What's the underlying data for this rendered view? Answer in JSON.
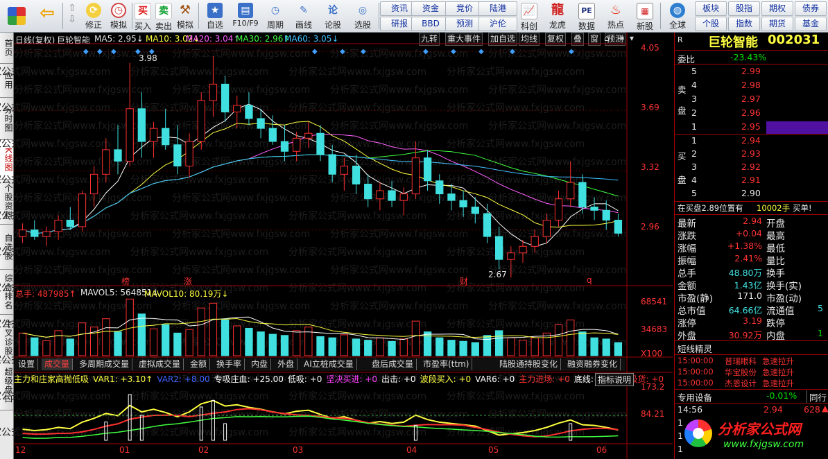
{
  "toolbar": {
    "buttons_left": [
      "修正",
      "模拟"
    ],
    "trade_buttons": [
      "买入",
      "卖出"
    ],
    "nav_buttons": [
      "自选",
      "F10/F9",
      "周期",
      "画线",
      "论股",
      "选股"
    ],
    "small_row1": [
      "资讯",
      "资金",
      "竞价",
      "陆港"
    ],
    "small_row2": [
      "研报",
      "BBD",
      "预测",
      "沪伦"
    ],
    "right_buttons": [
      "科创",
      "龙虎",
      "数据",
      "热点",
      "新股"
    ],
    "global_label": "全球",
    "right_small_row1": [
      "板块",
      "股指",
      "期权",
      "债券"
    ],
    "right_small_row2": [
      "个股",
      "指数",
      "期货",
      "基金"
    ],
    "icon_buy": "买",
    "icon_sell": "卖",
    "icon_brief": "论",
    "icon_pe": "PE"
  },
  "left_tabs": [
    "首页",
    "应用",
    "分时图",
    "K线图",
    "个股资料",
    "自选股",
    "综合排名",
    "牛叉诊股",
    "超级盘口"
  ],
  "chart_header": {
    "period": "日线(复权)",
    "name": "巨轮智能",
    "ma5": "MA5: 2.95↓",
    "ma10": "MA10: 3.02↓",
    "ma20": "MA20: 3.04↑",
    "ma30": "MA30: 2.96↑",
    "ma60": "MA60: 3.05↓",
    "buttons": [
      "九转",
      "重大事件",
      "加自选",
      "均线",
      "复权",
      "叠",
      "窗",
      "预测"
    ]
  },
  "price_axis": [
    "4.05",
    "3.69",
    "3.32",
    "2.96"
  ],
  "annotations": {
    "high": "3.98",
    "low": "2.67"
  },
  "event_markers": [
    "榜",
    "涨",
    "财",
    "q"
  ],
  "volume_header": {
    "total": "总手: 487985↑",
    "mavol5": "MAVOL5: 564851↓",
    "mavol10": "MAVOL10: 80.19万↓"
  },
  "volume_axis": [
    "68541",
    "34683",
    "X100"
  ],
  "indicator_tabs": [
    "设置",
    "成交量",
    "多周期成交量",
    "虚拟成交量",
    "金额",
    "换手率",
    "内盘",
    "外盘",
    "AI立桩成交量",
    "盘后成交量",
    "市盈率(ttm)",
    "陆股通持股变化",
    "融资融券变化"
  ],
  "indicator_header": {
    "title": "主力和庄家高抛低吸",
    "items": [
      "VAR1: +3.10↑",
      "VAR2: +8.00",
      "专吸庄血: +25.00",
      "低吸: +0",
      "坚决买进: +0",
      "出击: +0",
      "波段买入: +0",
      "VAR6: +0",
      "主力进场: +0",
      "底线: +0",
      "主力吸货: +0"
    ],
    "help": "指标说明"
  },
  "indicator_axis": [
    "173.2",
    "84.21"
  ],
  "date_axis": [
    "12",
    "01",
    "02",
    "03",
    "04",
    "05",
    "06"
  ],
  "quote": {
    "tag": "R",
    "title": "巨轮智能",
    "code": "002031",
    "weibi_label": "委比",
    "weibi": "-23.43%",
    "sell_label": [
      "卖",
      "盘"
    ],
    "buy_label": [
      "买",
      "盘"
    ],
    "sell": [
      {
        "lv": "5",
        "price": "2.99"
      },
      {
        "lv": "4",
        "price": "2.98"
      },
      {
        "lv": "3",
        "price": "2.97"
      },
      {
        "lv": "2",
        "price": "2.96"
      },
      {
        "lv": "1",
        "price": "2.95"
      }
    ],
    "buy": [
      {
        "lv": "1",
        "price": "2.94"
      },
      {
        "lv": "2",
        "price": "2.93"
      },
      {
        "lv": "3",
        "price": "2.92"
      },
      {
        "lv": "4",
        "price": "2.91"
      },
      {
        "lv": "5",
        "price": "2.90"
      }
    ],
    "position_text": "在买盘2.89位置有",
    "position_qty": "10002手",
    "position_tag": "买单!",
    "stats": [
      {
        "l": "最新",
        "v": "2.94",
        "l2": "开盘"
      },
      {
        "l": "涨跌",
        "v": "+0.04",
        "l2": "最高"
      },
      {
        "l": "涨幅",
        "v": "+1.38%",
        "l2": "最低"
      },
      {
        "l": "振幅",
        "v": "2.41%",
        "l2": "量比"
      },
      {
        "l": "总手",
        "v": "48.80万",
        "l2": "换手"
      },
      {
        "l": "金额",
        "v": "1.43亿",
        "l2": "换手(实)"
      },
      {
        "l": "市盈(静)",
        "v": "171.0",
        "l2": "市盈(动)"
      },
      {
        "l": "总市值",
        "v": "64.66亿",
        "l2": "流通值"
      },
      {
        "l": "涨停",
        "v": "3.19",
        "l2": "跌停"
      },
      {
        "l": "外盘",
        "v": "30.92万",
        "l2": "内盘"
      }
    ],
    "stat_extra_liutong": "5",
    "stat_extra_neipan": "1",
    "elf_title": "短线精灵",
    "elf": [
      {
        "time": "15:00:00",
        "name": "普瑞眼科",
        "event": "急速拉升"
      },
      {
        "time": "15:00:00",
        "name": "华宝股份",
        "event": "急速拉升"
      },
      {
        "time": "15:00:00",
        "name": "杰恩设计",
        "event": "急速拉升"
      }
    ],
    "device_label": "专用设备",
    "device_chg": "-0.01%",
    "device_peer": "同行",
    "tick": {
      "time": "14:56",
      "price": "2.94",
      "vol": "628"
    },
    "tick_rows": [
      "1",
      "1",
      "1"
    ],
    "brand": "分析家公式网",
    "brand_url": "www.fxjgsw.com"
  },
  "watermark": "分析家公式网www.fxjgsw.com",
  "chart_data": {
    "type": "candlestick",
    "price_range": [
      2.62,
      4.08
    ],
    "ohlc": [
      [
        2.92,
        3.0,
        2.88,
        2.96
      ],
      [
        2.96,
        3.02,
        2.9,
        2.92
      ],
      [
        2.92,
        2.98,
        2.86,
        2.95
      ],
      [
        2.95,
        3.05,
        2.9,
        3.02
      ],
      [
        3.02,
        3.1,
        2.96,
        2.98
      ],
      [
        2.98,
        3.2,
        2.95,
        3.18
      ],
      [
        3.18,
        3.35,
        3.1,
        3.3
      ],
      [
        3.3,
        3.52,
        3.25,
        3.45
      ],
      [
        3.45,
        3.6,
        3.3,
        3.38
      ],
      [
        3.38,
        3.98,
        3.35,
        3.7
      ],
      [
        3.7,
        3.8,
        3.4,
        3.5
      ],
      [
        3.5,
        3.62,
        3.4,
        3.58
      ],
      [
        3.58,
        3.7,
        3.45,
        3.48
      ],
      [
        3.48,
        3.6,
        3.3,
        3.35
      ],
      [
        3.35,
        3.55,
        3.28,
        3.5
      ],
      [
        3.5,
        3.8,
        3.45,
        3.75
      ],
      [
        3.75,
        4.02,
        3.65,
        3.85
      ],
      [
        3.85,
        3.9,
        3.62,
        3.68
      ],
      [
        3.68,
        3.78,
        3.58,
        3.72
      ],
      [
        3.72,
        3.8,
        3.6,
        3.64
      ],
      [
        3.64,
        3.7,
        3.52,
        3.58
      ],
      [
        3.58,
        3.66,
        3.48,
        3.5
      ],
      [
        3.5,
        3.6,
        3.38,
        3.44
      ],
      [
        3.44,
        3.56,
        3.38,
        3.52
      ],
      [
        3.52,
        3.62,
        3.46,
        3.55
      ],
      [
        3.55,
        3.6,
        3.38,
        3.42
      ],
      [
        3.42,
        3.48,
        3.25,
        3.3
      ],
      [
        3.3,
        3.4,
        3.2,
        3.35
      ],
      [
        3.35,
        3.42,
        3.18,
        3.24
      ],
      [
        3.24,
        3.3,
        3.1,
        3.15
      ],
      [
        3.15,
        3.25,
        3.08,
        3.2
      ],
      [
        3.2,
        3.26,
        3.1,
        3.14
      ],
      [
        3.14,
        3.22,
        3.05,
        3.18
      ],
      [
        3.18,
        3.5,
        3.15,
        3.4
      ],
      [
        3.4,
        3.45,
        3.2,
        3.26
      ],
      [
        3.26,
        3.3,
        3.12,
        3.18
      ],
      [
        3.18,
        3.24,
        3.08,
        3.14
      ],
      [
        3.14,
        3.2,
        3.04,
        3.1
      ],
      [
        3.1,
        3.16,
        3.0,
        3.06
      ],
      [
        3.06,
        3.12,
        2.88,
        2.92
      ],
      [
        2.92,
        2.98,
        2.72,
        2.78
      ],
      [
        2.78,
        2.86,
        2.67,
        2.82
      ],
      [
        2.82,
        2.9,
        2.76,
        2.86
      ],
      [
        2.86,
        2.96,
        2.82,
        2.92
      ],
      [
        2.92,
        3.06,
        2.88,
        3.02
      ],
      [
        3.02,
        3.2,
        2.98,
        3.15
      ],
      [
        3.15,
        3.38,
        3.1,
        3.25
      ],
      [
        3.25,
        3.3,
        3.06,
        3.1
      ],
      [
        3.1,
        3.16,
        3.02,
        3.08
      ],
      [
        3.08,
        3.14,
        2.96,
        3.02
      ],
      [
        3.02,
        3.06,
        2.92,
        2.94
      ]
    ],
    "volume": [
      38,
      30,
      25,
      42,
      28,
      55,
      48,
      62,
      40,
      95,
      70,
      45,
      52,
      38,
      44,
      80,
      88,
      60,
      50,
      46,
      40,
      36,
      34,
      42,
      48,
      32,
      30,
      35,
      28,
      26,
      30,
      24,
      28,
      58,
      40,
      30,
      26,
      24,
      22,
      34,
      42,
      30,
      26,
      30,
      38,
      52,
      60,
      40,
      30,
      28,
      22
    ]
  }
}
